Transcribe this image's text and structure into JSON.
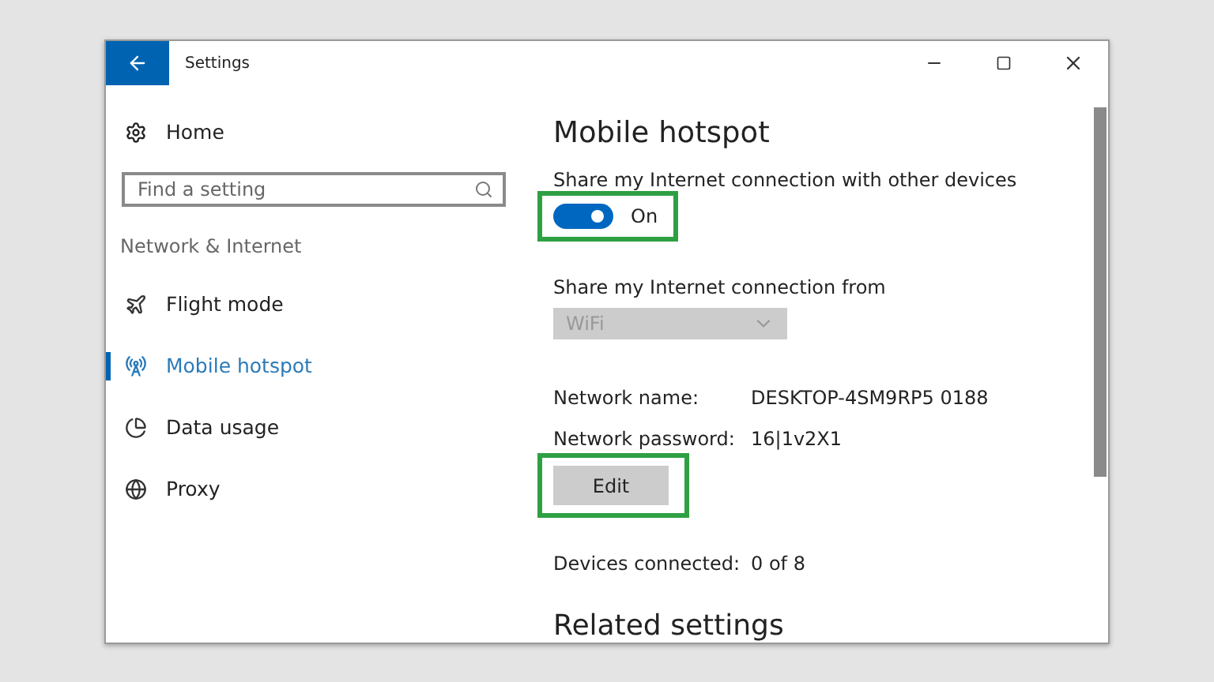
{
  "window": {
    "title": "Settings"
  },
  "sidebar": {
    "home": "Home",
    "search": {
      "placeholder": "Find a setting"
    },
    "section": "Network & Internet",
    "items": [
      {
        "label": "Flight mode",
        "selected": false
      },
      {
        "label": "Mobile hotspot",
        "selected": true
      },
      {
        "label": "Data usage",
        "selected": false
      },
      {
        "label": "Proxy",
        "selected": false
      }
    ]
  },
  "content": {
    "heading": "Mobile hotspot",
    "share_label": "Share my Internet connection with other devices",
    "toggle": {
      "on": true,
      "label": "On",
      "highlighted": true
    },
    "from_label": "Share my Internet connection from",
    "dropdown": {
      "value": "WiFi",
      "disabled": true
    },
    "details": [
      {
        "label": "Network name:",
        "value": "DESKTOP-4SM9RP5 0188"
      },
      {
        "label": "Network password:",
        "value": "16|1v2X1"
      }
    ],
    "edit_button": {
      "label": "Edit",
      "highlighted": true
    },
    "devices": {
      "label": "Devices connected:",
      "value": "0 of 8"
    },
    "related_heading": "Related settings"
  }
}
